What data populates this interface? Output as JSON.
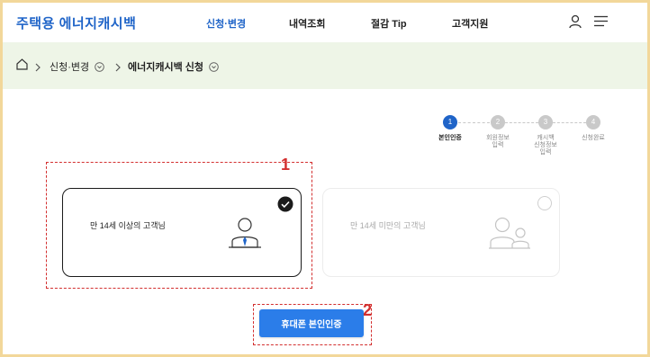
{
  "header": {
    "logo": "주택용 에너지캐시백",
    "nav": [
      {
        "label": "신청·변경",
        "active": true
      },
      {
        "label": "내역조회",
        "active": false
      },
      {
        "label": "절감 Tip",
        "active": false
      },
      {
        "label": "고객지원",
        "active": false
      }
    ],
    "icons": [
      "user-icon",
      "menu-icon"
    ]
  },
  "breadcrumb": {
    "items": [
      "신청·변경",
      "에너지캐시백 신청"
    ]
  },
  "steps": [
    {
      "number": "1",
      "label": "본인인증",
      "active": true
    },
    {
      "number": "2",
      "label": "회원정보\n입력",
      "active": false
    },
    {
      "number": "3",
      "label": "캐시백\n신청정보\n입력",
      "active": false
    },
    {
      "number": "4",
      "label": "신청완료",
      "active": false
    }
  ],
  "options": {
    "adult": {
      "label": "만 14세 이상의 고객님",
      "selected": true
    },
    "minor": {
      "label": "만 14세 미만의 고객님",
      "selected": false
    }
  },
  "auth_button": {
    "label": "휴대폰 본인인증"
  },
  "annotations": {
    "first": "1",
    "second": "2"
  },
  "colors": {
    "brand": "#1f64c8",
    "button": "#2b7de9",
    "annotation": "#d32f2f",
    "breadcrumb_bg": "#eef5e7"
  }
}
